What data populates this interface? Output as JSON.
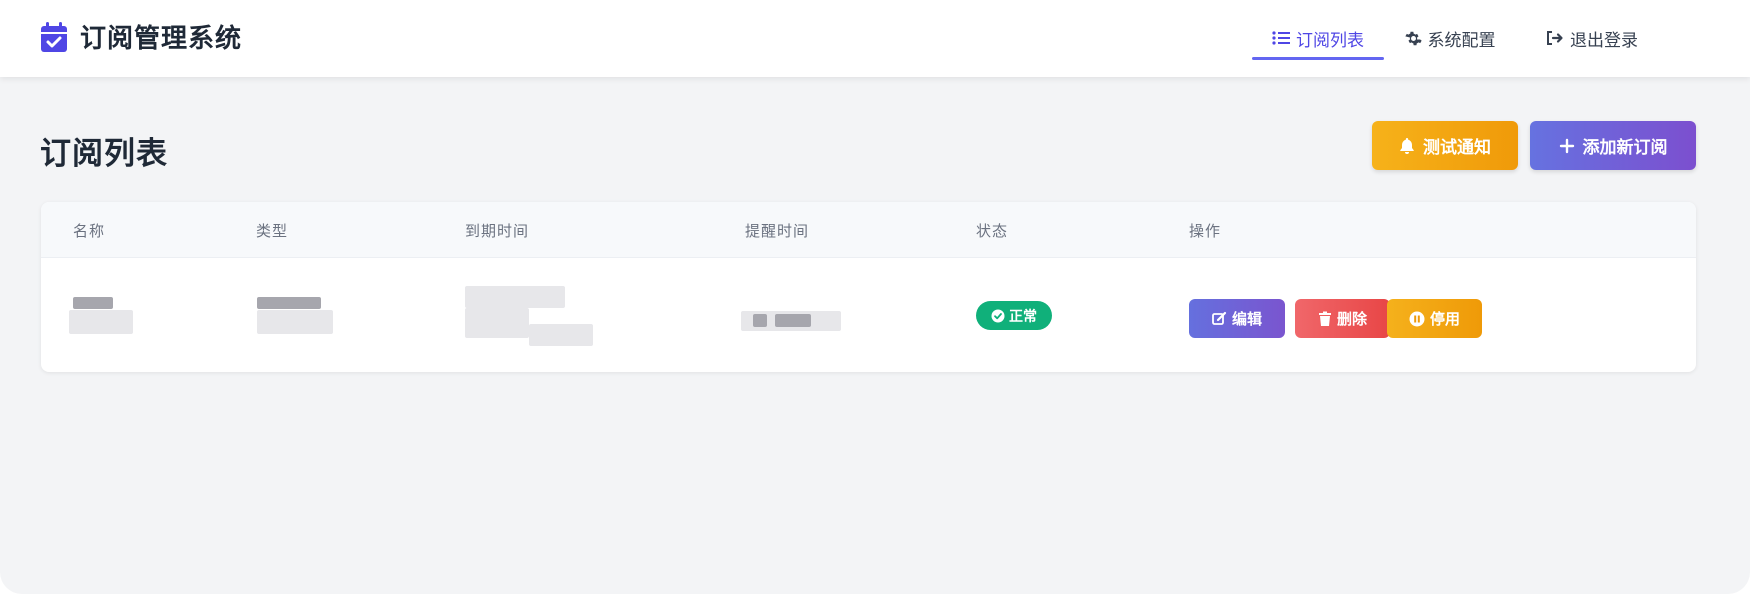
{
  "app": {
    "title": "订阅管理系统",
    "brand_color": "#4f46e5"
  },
  "nav": {
    "items": [
      {
        "label": "订阅列表",
        "icon": "list-icon",
        "active": true
      },
      {
        "label": "系统配置",
        "icon": "gear-icon",
        "active": false
      },
      {
        "label": "退出登录",
        "icon": "logout-icon",
        "active": false
      }
    ]
  },
  "page": {
    "title": "订阅列表",
    "test_notify_label": "测试通知",
    "add_label": "添加新订阅"
  },
  "table": {
    "columns": [
      "名称",
      "类型",
      "到期时间",
      "提醒时间",
      "状态",
      "操作"
    ],
    "rows": [
      {
        "status": "正常",
        "status_color": "#10b07a",
        "actions": [
          "编辑",
          "删除",
          "停用"
        ]
      }
    ]
  }
}
